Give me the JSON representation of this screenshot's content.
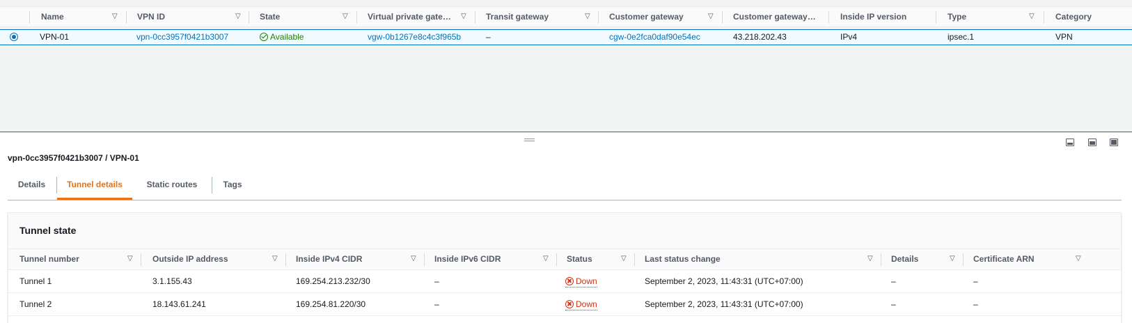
{
  "vpn_table": {
    "columns": [
      {
        "label": "Name"
      },
      {
        "label": "VPN ID"
      },
      {
        "label": "State"
      },
      {
        "label": "Virtual private gateway"
      },
      {
        "label": "Transit gateway"
      },
      {
        "label": "Customer gateway"
      },
      {
        "label": "Customer gateway ad..."
      },
      {
        "label": "Inside IP version"
      },
      {
        "label": "Type"
      },
      {
        "label": "Category"
      }
    ],
    "row": {
      "name": "VPN-01",
      "vpn_id": "vpn-0cc3957f0421b3007",
      "state": "Available",
      "virtual_private_gateway": "vgw-0b1267e8c4c3f965b",
      "transit_gateway": "–",
      "customer_gateway": "cgw-0e2fca0daf90e54ec",
      "customer_gateway_address": "43.218.202.43",
      "inside_ip_version": "IPv4",
      "type": "ipsec.1",
      "category": "VPN"
    }
  },
  "detail": {
    "title": "vpn-0cc3957f0421b3007 / VPN-01",
    "tabs": [
      {
        "label": "Details"
      },
      {
        "label": "Tunnel details"
      },
      {
        "label": "Static routes"
      },
      {
        "label": "Tags"
      }
    ],
    "active_tab": "Tunnel details"
  },
  "tunnel_state": {
    "title": "Tunnel state",
    "columns": [
      {
        "label": "Tunnel number"
      },
      {
        "label": "Outside IP address"
      },
      {
        "label": "Inside IPv4 CIDR"
      },
      {
        "label": "Inside IPv6 CIDR"
      },
      {
        "label": "Status"
      },
      {
        "label": "Last status change"
      },
      {
        "label": "Details"
      },
      {
        "label": "Certificate ARN"
      }
    ],
    "rows": [
      {
        "tunnel": "Tunnel 1",
        "outside_ip": "3.1.155.43",
        "inside_ipv4": "169.254.213.232/30",
        "inside_ipv6": "–",
        "status": "Down",
        "last_change": "September 2, 2023, 11:43:31 (UTC+07:00)",
        "details": "–",
        "cert_arn": "–"
      },
      {
        "tunnel": "Tunnel 2",
        "outside_ip": "18.143.61.241",
        "inside_ipv4": "169.254.81.220/30",
        "inside_ipv6": "–",
        "status": "Down",
        "last_change": "September 2, 2023, 11:43:31 (UTC+07:00)",
        "details": "–",
        "cert_arn": "–"
      }
    ]
  },
  "colors": {
    "link": "#0073bb",
    "available": "#1d8102",
    "down": "#d13212",
    "active_tab": "#ec7211"
  }
}
